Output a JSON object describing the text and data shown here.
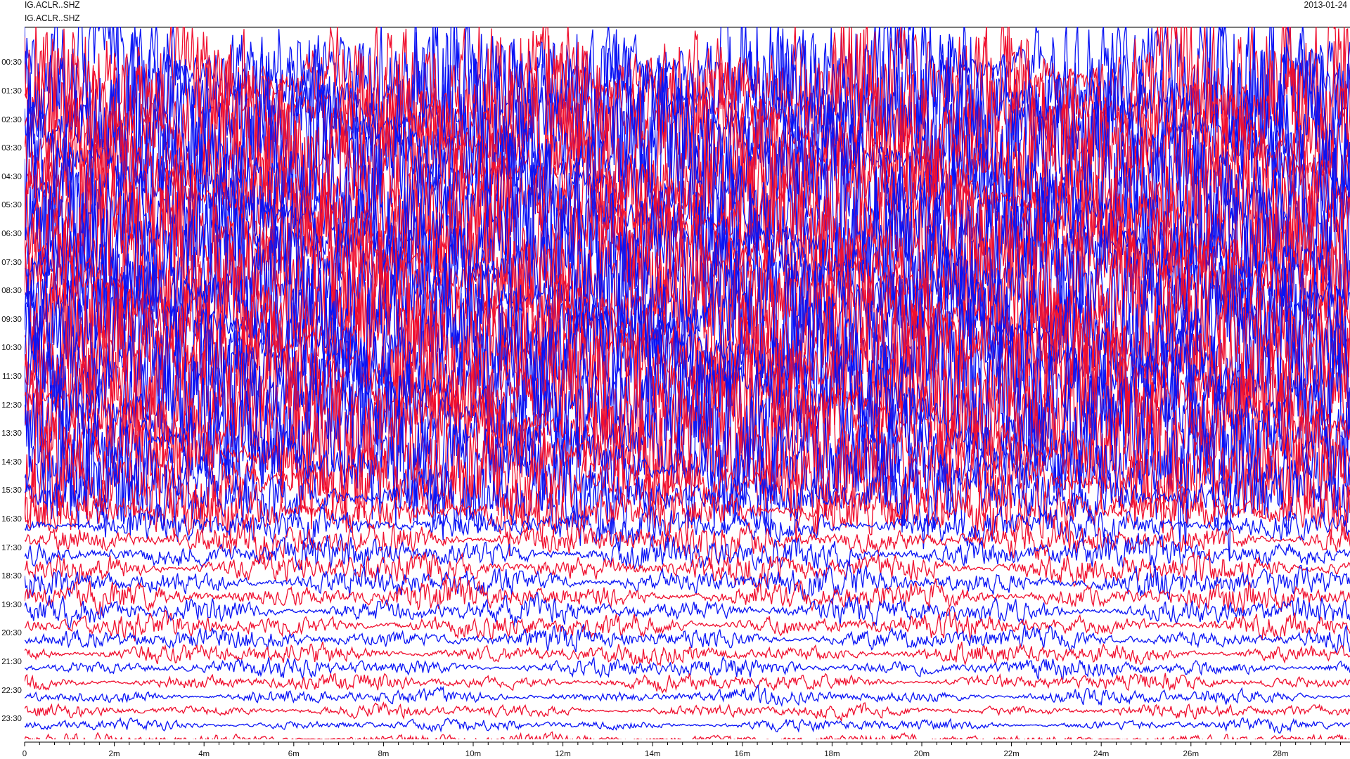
{
  "header": {
    "station_lines": [
      "IG.ACLR..SHZ",
      "IG.ACLR..SHZ"
    ],
    "date": "2013-01-24"
  },
  "y_labels": [
    "00:30",
    "01:30",
    "02:30",
    "03:30",
    "04:30",
    "05:30",
    "06:30",
    "07:30",
    "08:30",
    "09:30",
    "10:30",
    "11:30",
    "12:30",
    "13:30",
    "14:30",
    "15:30",
    "16:30",
    "17:30",
    "18:30",
    "19:30",
    "20:30",
    "21:30",
    "22:30",
    "23:30"
  ],
  "x_labels": [
    "0",
    "2m",
    "4m",
    "6m",
    "8m",
    "10m",
    "12m",
    "14m",
    "16m",
    "18m",
    "20m",
    "22m",
    "24m",
    "26m",
    "28m"
  ]
}
